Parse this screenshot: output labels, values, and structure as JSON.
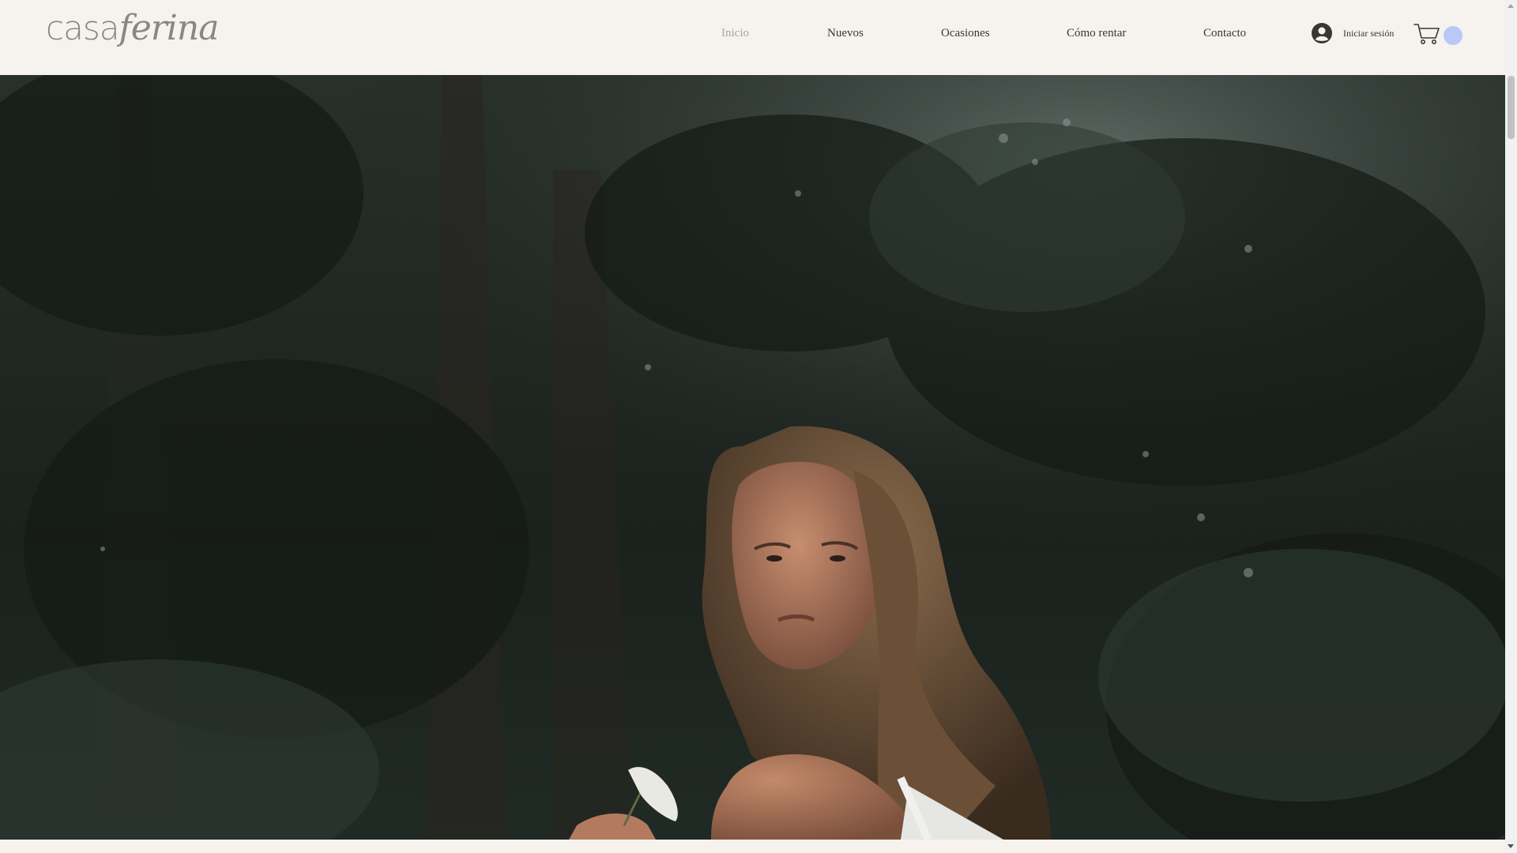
{
  "brand": {
    "logo_part1": "casa",
    "logo_part2": "ferina",
    "text_color": "#8a8680"
  },
  "nav": {
    "items": [
      {
        "label": "Inicio",
        "active": true
      },
      {
        "label": "Nuevos",
        "active": false
      },
      {
        "label": "Ocasiones",
        "active": false
      },
      {
        "label": "Cómo rentar",
        "active": false
      },
      {
        "label": "Contacto",
        "active": false
      }
    ]
  },
  "account": {
    "login_label": "Iniciar sesión",
    "icon": "user-avatar-icon"
  },
  "cart": {
    "icon": "shopping-cart-icon",
    "badge_color": "#b9c8f5"
  },
  "hero": {
    "description": "",
    "dominant_color": "#1d2420"
  },
  "colors": {
    "header_bg": "#f6f3ee",
    "nav_text": "#3a3632",
    "nav_active": "#a9a49d"
  }
}
